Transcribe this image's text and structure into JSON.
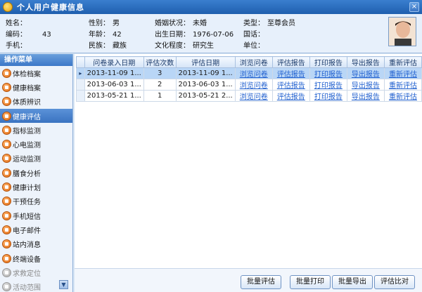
{
  "window": {
    "title": "个人用户健康信息",
    "close": "×"
  },
  "info": {
    "name_label": "姓名：",
    "name_value": "",
    "gender_label": "性别：",
    "gender_value": "男",
    "marital_label": "婚姻状况：",
    "marital_value": "未婚",
    "type_label": "类型：",
    "type_value": "至尊会员",
    "code_label": "编码：",
    "code_value": "43",
    "age_label": "年龄：",
    "age_value": "42",
    "birth_label": "出生日期：",
    "birth_value": "1976-07-06",
    "nation_label": "国话：",
    "nation_value": "",
    "phone_label": "手机：",
    "phone_value": "",
    "ethnic_label": "民族：",
    "ethnic_value": "藏族",
    "edu_label": "文化程度：",
    "edu_value": "研究生",
    "unit_label": "单位：",
    "unit_value": ""
  },
  "sidebar": {
    "header": "操作菜单",
    "items": [
      {
        "label": "体检档案"
      },
      {
        "label": "健康档案"
      },
      {
        "label": "体质辨识"
      },
      {
        "label": "健康评估"
      },
      {
        "label": "指标监测"
      },
      {
        "label": "心电监测"
      },
      {
        "label": "运动监测"
      },
      {
        "label": "膳食分析"
      },
      {
        "label": "健康计划"
      },
      {
        "label": "干预任务"
      },
      {
        "label": "手机短信"
      },
      {
        "label": "电子邮件"
      },
      {
        "label": "站内消息"
      },
      {
        "label": "终端设备"
      },
      {
        "label": "求救定位"
      },
      {
        "label": "活动范围"
      }
    ]
  },
  "grid": {
    "headers": [
      "问卷录入日期",
      "评估次数",
      "评估日期",
      "浏览问卷",
      "评估报告",
      "打印报告",
      "导出报告",
      "重新评估"
    ],
    "rows": [
      {
        "entry_date": "2013-11-09 1...",
        "count": "3",
        "eval_date": "2013-11-09 1...",
        "view": "浏览问卷",
        "report": "评估报告",
        "print": "打印报告",
        "export": "导出报告",
        "reeval": "重新评估"
      },
      {
        "entry_date": "2013-06-03 1...",
        "count": "2",
        "eval_date": "2013-06-03 1...",
        "view": "浏览问卷",
        "report": "评估报告",
        "print": "打印报告",
        "export": "导出报告",
        "reeval": "重新评估"
      },
      {
        "entry_date": "2013-05-21 1...",
        "count": "1",
        "eval_date": "2013-05-21 2...",
        "view": "浏览问卷",
        "report": "评估报告",
        "print": "打印报告",
        "export": "导出报告",
        "reeval": "重新评估"
      }
    ],
    "row_indicator": "▸"
  },
  "buttons": {
    "batch_eval": "批量评估",
    "batch_print": "批量打印",
    "batch_export": "批量导出",
    "eval_compare": "评估比对"
  },
  "scroll_down": "▼"
}
